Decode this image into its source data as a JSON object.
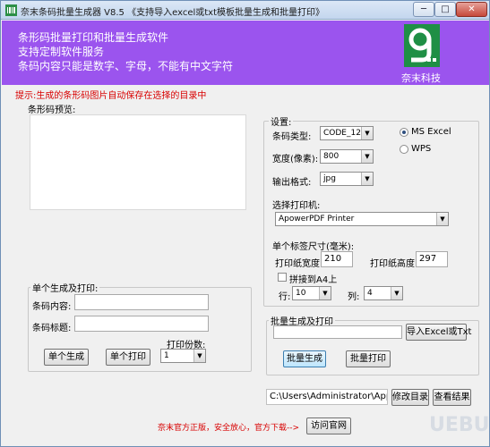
{
  "window": {
    "title": "奈末条码批量生成器 V8.5   《支持导入excel或txt模板批量生成和批量打印》",
    "minimize_label": "─",
    "maximize_label": "□",
    "close_label": "✕"
  },
  "banner": {
    "line1": "条形码批量打印和批量生成软件",
    "line2": "支持定制软件服务",
    "line3": "条码内容只能是数字、字母，不能有中文字符",
    "logo_text": "奈末科技",
    "bg_color": "#9b54ee",
    "logo_color": "#1f8f45"
  },
  "hint": "提示:生成的条形码图片自动保存在选择的目录中",
  "preview": {
    "label": "条形码预览:"
  },
  "settings": {
    "title": "设置:",
    "barcode_type_label": "条码类型:",
    "barcode_type_value": "CODE_128",
    "width_label": "宽度(像素):",
    "width_value": "800",
    "format_label": "输出格式:",
    "format_value": "jpg",
    "excel_option": "MS  Excel",
    "wps_option": "WPS",
    "printer_label": "选择打印机:",
    "printer_value": "ApowerPDF Printer",
    "label_size_label": "单个标签尺寸(毫米):",
    "print_width_label": "打印纸宽度:",
    "print_width_value": "210",
    "print_height_label": "打印纸高度:",
    "print_height_value": "297",
    "a4_label": "拼接到A4上",
    "rows_label": "行:",
    "rows_value": "10",
    "cols_label": "列:",
    "cols_value": "4"
  },
  "single": {
    "title": "单个生成及打印:",
    "content_label": "条码内容:",
    "content_value": "",
    "caption_label": "条码标题:",
    "caption_value": "",
    "copies_label": "打印份数:",
    "copies_value": "1",
    "generate_button": "单个生成",
    "print_button": "单个打印"
  },
  "batch": {
    "title": "批量生成及打印",
    "file_value": "",
    "import_button": "导入Excel或Txt",
    "generate_button": "批量生成",
    "print_button": "批量打印"
  },
  "output": {
    "path_value": "C:\\Users\\Administrator\\AppData\\I",
    "change_dir_button": "修改目录",
    "view_results_button": "查看结果"
  },
  "footer": {
    "note": "奈末官方正版，安全放心，官方下载-->",
    "visit_button": "访问官网"
  },
  "watermark": "UEBUG"
}
